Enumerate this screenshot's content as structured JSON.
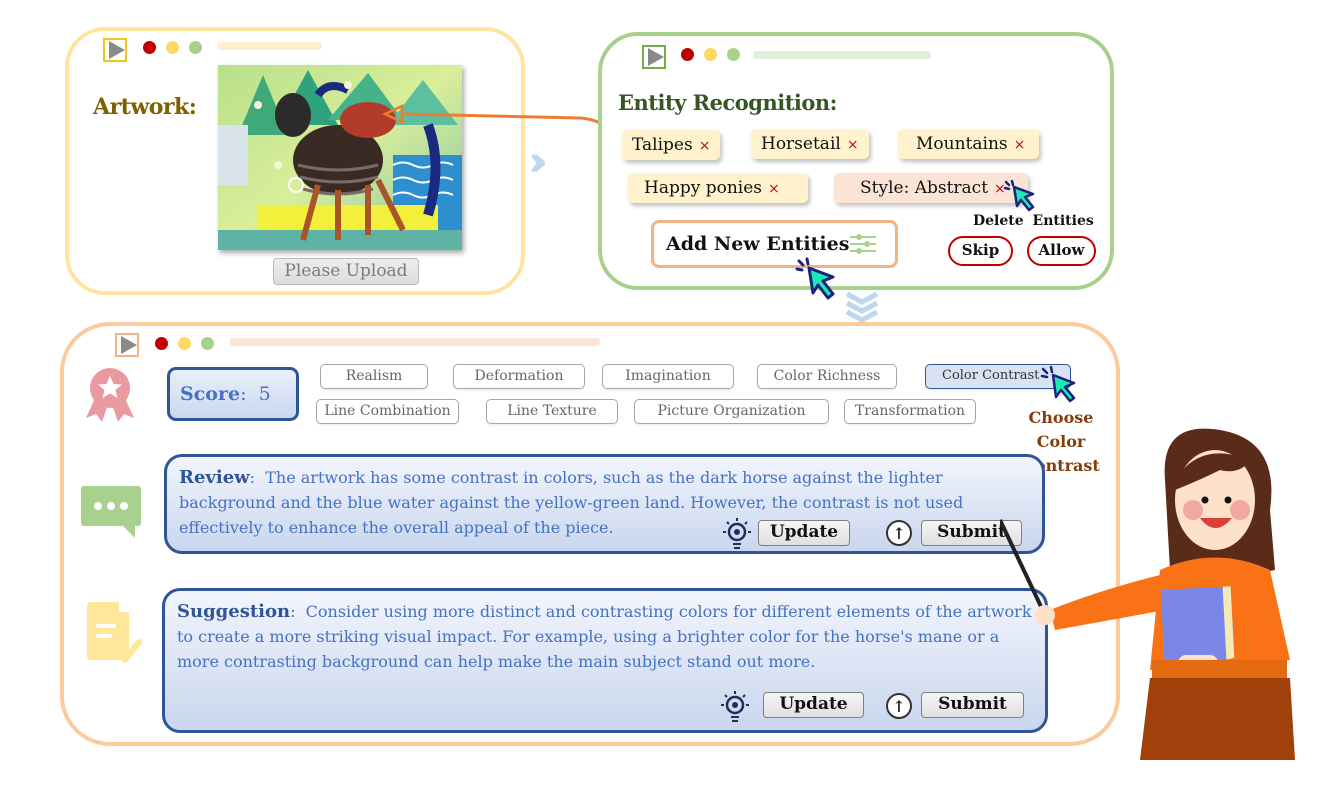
{
  "artwork_window": {
    "label": "Artwork:",
    "upload_button": "Please Upload",
    "image_description": "Child's abstract painting of a dark horse with red saddle in front of green mountains and blue water"
  },
  "entity_window": {
    "label": "Entity Recognition:",
    "entities": [
      {
        "name": "Talipes",
        "remove": "×"
      },
      {
        "name": "Horsetail",
        "remove": "×"
      },
      {
        "name": "Mountains",
        "remove": "×"
      },
      {
        "name": "Happy ponies",
        "remove": "×"
      },
      {
        "name": "Style: Abstract",
        "remove": "×"
      }
    ],
    "add_button": "Add New Entities",
    "delete_label": "Delete Entities",
    "skip_button": "Skip",
    "allow_button": "Allow"
  },
  "score_window": {
    "score_label": "Score",
    "score_sep": ":",
    "score_value": "5",
    "criteria_row1": [
      "Realism",
      "Deformation",
      "Imagination",
      "Color Richness",
      "Color Contrast"
    ],
    "criteria_row2": [
      "Line Combination",
      "Line Texture",
      "Picture Organization",
      "Transformation"
    ],
    "selected_criterion": "Color Contrast",
    "choose_annotation": [
      "Choose",
      "Color Contrast"
    ],
    "review": {
      "label": "Review",
      "sep": ":",
      "text": "The artwork has some contrast in colors, such as the dark horse against the lighter background and the blue water against the yellow-green land. However, the contrast is not used effectively to enhance the overall appeal of the piece.",
      "update_button": "Update",
      "submit_button": "Submit"
    },
    "suggestion": {
      "label": "Suggestion",
      "sep": ":",
      "text": "Consider using more distinct and contrasting colors for different elements of the artwork to create a more striking visual impact. For example, using a brighter color for the horse's mane or a more contrasting background can help make the main subject stand out more.",
      "update_button": "Update",
      "submit_button": "Submit"
    }
  },
  "colors": {
    "artwork_frame": "#fde5a0",
    "entity_frame": "#a8d08d",
    "score_frame": "#fbcb9e",
    "panel_border": "#2f5597",
    "panel_text": "#4472c4",
    "delete_x": "#c00000",
    "cursor": "#1de9b6"
  }
}
